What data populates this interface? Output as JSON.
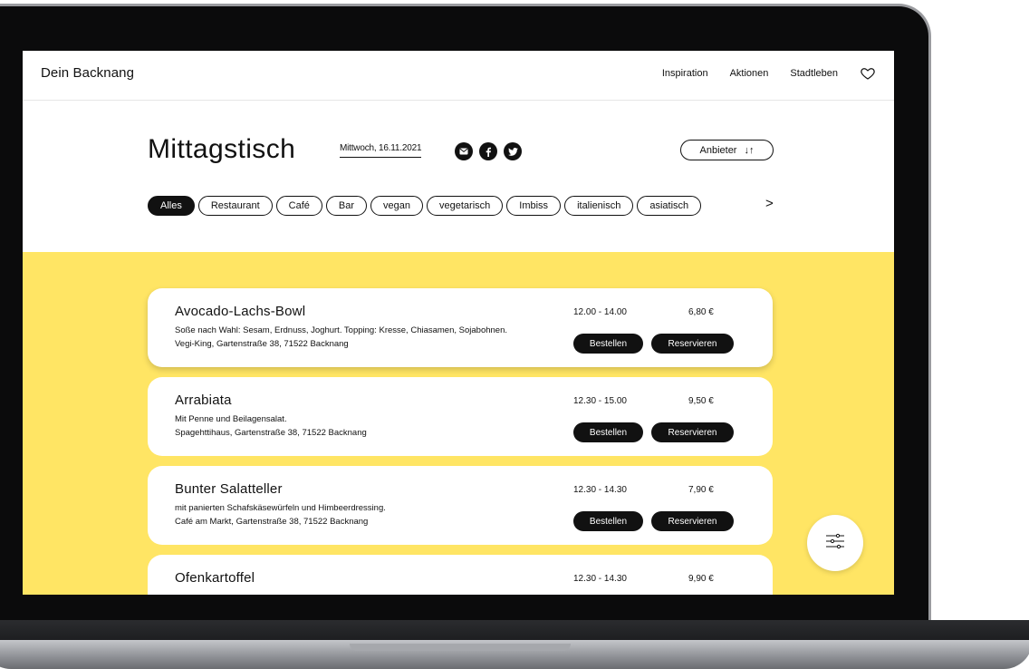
{
  "header": {
    "brand": "Dein Backnang",
    "nav": [
      "Inspiration",
      "Aktionen",
      "Stadtleben"
    ],
    "heart_icon": "heart-icon"
  },
  "page": {
    "title": "Mittagstisch",
    "date": "Mittwoch, 16.11.2021",
    "socials": [
      "mail-icon",
      "facebook-icon",
      "twitter-icon"
    ],
    "sort_label": "Anbieter",
    "sort_icon": "↓↑"
  },
  "filters": {
    "chips": [
      "Alles",
      "Restaurant",
      "Café",
      "Bar",
      "vegan",
      "vegetarisch",
      "Imbiss",
      "italienisch",
      "asiatisch"
    ],
    "active": "Alles",
    "next_icon": ">"
  },
  "meals": [
    {
      "title": "Avocado-Lachs-Bowl",
      "description": "Soße nach Wahl: Sesam, Erdnuss, Joghurt. Topping: Kresse, Chiasamen, Sojabohnen.",
      "address": "Vegi-King, Gartenstraße 38, 71522 Backnang",
      "time": "12.00 - 14.00",
      "price": "6,80 €",
      "order_label": "Bestellen",
      "reserve_label": "Reservieren"
    },
    {
      "title": "Arrabiata",
      "description": "Mit Penne und Beilagensalat.",
      "address": "Spagehttihaus, Gartenstraße 38, 71522 Backnang",
      "time": "12.30 - 15.00",
      "price": "9,50 €",
      "order_label": "Bestellen",
      "reserve_label": "Reservieren"
    },
    {
      "title": "Bunter Salatteller",
      "description": "mit panierten Schafskäsewürfeln und Himbeerdressing.",
      "address": "Café am Markt, Gartenstraße 38, 71522 Backnang",
      "time": "12.30 - 14.30",
      "price": "7,90 €",
      "order_label": "Bestellen",
      "reserve_label": "Reservieren"
    },
    {
      "title": "Ofenkartoffel",
      "description": "",
      "address": "",
      "time": "12.30 - 14.30",
      "price": "9,90 €"
    }
  ],
  "colors": {
    "accent_yellow": "#ffe564",
    "ink": "#111111"
  },
  "fab_icon": "filter-sliders-icon"
}
